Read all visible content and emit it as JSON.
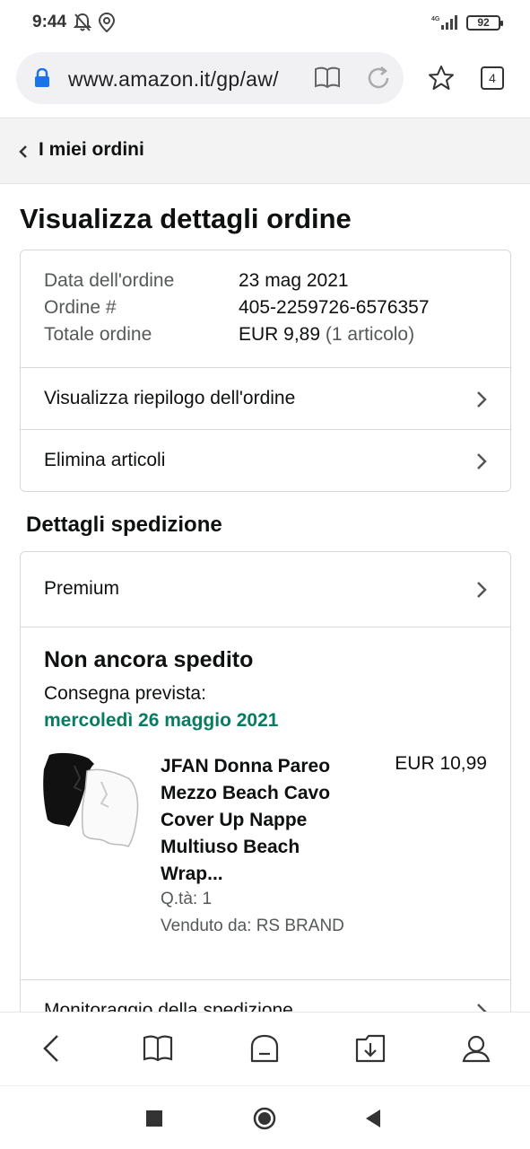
{
  "status_bar": {
    "time": "9:44",
    "network": "4G",
    "battery": "92",
    "icons": [
      "notifications-off-icon",
      "location-icon",
      "signal-icon",
      "battery-icon"
    ]
  },
  "browser": {
    "url": "www.amazon.it/gp/aw/",
    "tab_count": "4",
    "icons": [
      "lock-icon",
      "reader-mode-icon",
      "reload-icon",
      "bookmark-star-icon",
      "tabs-icon"
    ]
  },
  "nav": {
    "back_label": "I miei ordini"
  },
  "page": {
    "title": "Visualizza dettagli ordine"
  },
  "order": {
    "date_label": "Data dell'ordine",
    "date_value": "23 mag 2021",
    "number_label": "Ordine #",
    "number_value": "405-2259726-6576357",
    "total_label": "Totale ordine",
    "total_value": "EUR 9,89",
    "total_items": "(1 articolo)",
    "actions": [
      {
        "label": "Visualizza riepilogo dell'ordine"
      },
      {
        "label": "Elimina articoli"
      }
    ]
  },
  "shipment": {
    "section_title": "Dettagli spedizione",
    "method": "Premium",
    "status": "Non ancora spedito",
    "delivery_label": "Consegna prevista:",
    "delivery_date": "mercoledì 26 maggio 2021",
    "delivery_color": "#067d62",
    "product": {
      "title": "JFAN Donna Pareo Mezzo Beach Cavo Cover Up Nappe Multiuso Beach Wrap...",
      "price": "EUR 10,99",
      "qty": "Q.tà: 1",
      "seller": "Venduto da: RS BRAND"
    },
    "tracking_label": "Monitoraggio della spedizione"
  },
  "toolbar": {
    "icons": [
      "back-icon",
      "bookmarks-icon",
      "home-icon",
      "downloads-icon",
      "profile-icon"
    ]
  },
  "system_nav": {
    "icons": [
      "recents-icon",
      "home-circle-icon",
      "back-triangle-icon"
    ]
  }
}
